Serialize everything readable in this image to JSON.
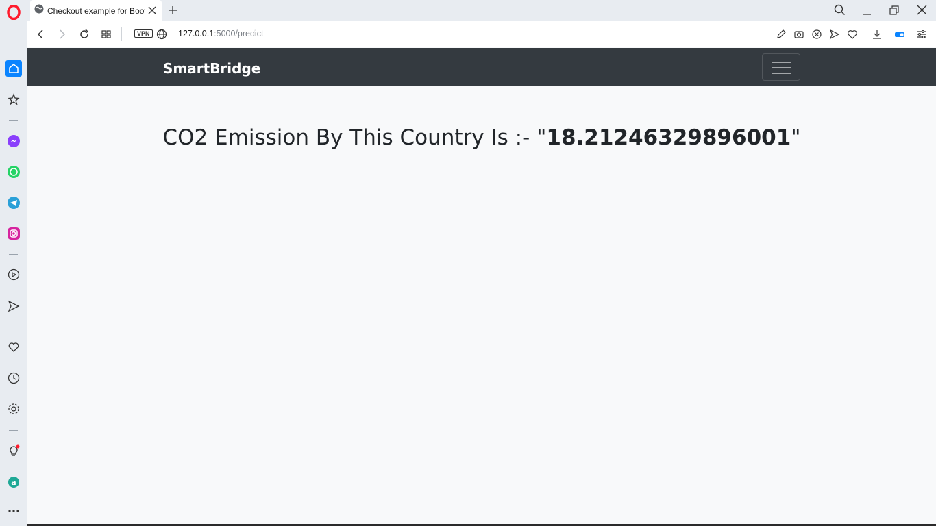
{
  "browser": {
    "tab_title": "Checkout example for Bootstrap",
    "url_host": "127.0.0.1",
    "url_rest": ":5000/predict",
    "vpn_label": "VPN"
  },
  "sidebar": {
    "items": [
      "home-icon",
      "bookmarks-icon",
      "messenger-icon",
      "whatsapp-icon",
      "telegram-icon",
      "instagram-icon",
      "player-icon",
      "send-icon",
      "heart-icon",
      "history-icon",
      "settings-icon",
      "tips-icon",
      "aria-icon",
      "more-icon"
    ]
  },
  "page": {
    "brand": "SmartBridge",
    "result_prefix": "CO2 Emission By This Country Is :- \"",
    "result_value": "18.21246329896001",
    "result_suffix": "\""
  },
  "colors": {
    "navbar": "#343a40",
    "accent": "#0a84ff",
    "opera_red": "#ff1b2d"
  }
}
